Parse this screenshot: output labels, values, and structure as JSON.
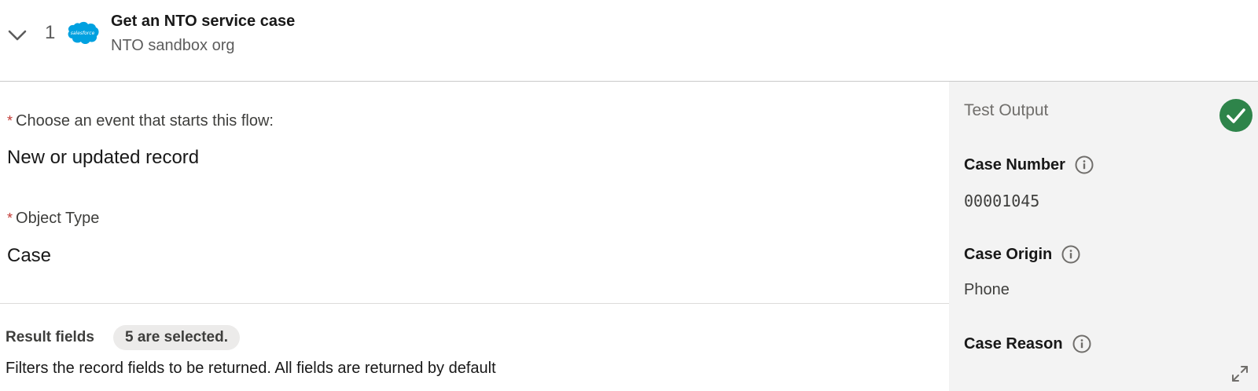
{
  "header": {
    "step_number": "1",
    "title": "Get an NTO service case",
    "subtitle": "NTO sandbox org",
    "logo_text": "salesforce"
  },
  "trigger": {
    "required_mark": "*",
    "event_label": "Choose an event that starts this flow:",
    "event_value": "New or updated record",
    "object_label": "Object Type",
    "object_value": "Case"
  },
  "result_fields": {
    "label": "Result fields",
    "selected_badge": "5 are selected.",
    "help_text": "Filters the record fields to be returned. All fields are returned by default"
  },
  "test_output": {
    "title": "Test Output",
    "status_icon": "check-circle-icon",
    "fields": [
      {
        "label": "Case Number",
        "value": "00001045"
      },
      {
        "label": "Case Origin",
        "value": "Phone"
      },
      {
        "label": "Case Reason",
        "value": ""
      }
    ]
  },
  "colors": {
    "success": "#2e844a",
    "salesforce_blue": "#00a1e0",
    "required": "#c23934",
    "panel_bg": "#f3f3f3"
  }
}
